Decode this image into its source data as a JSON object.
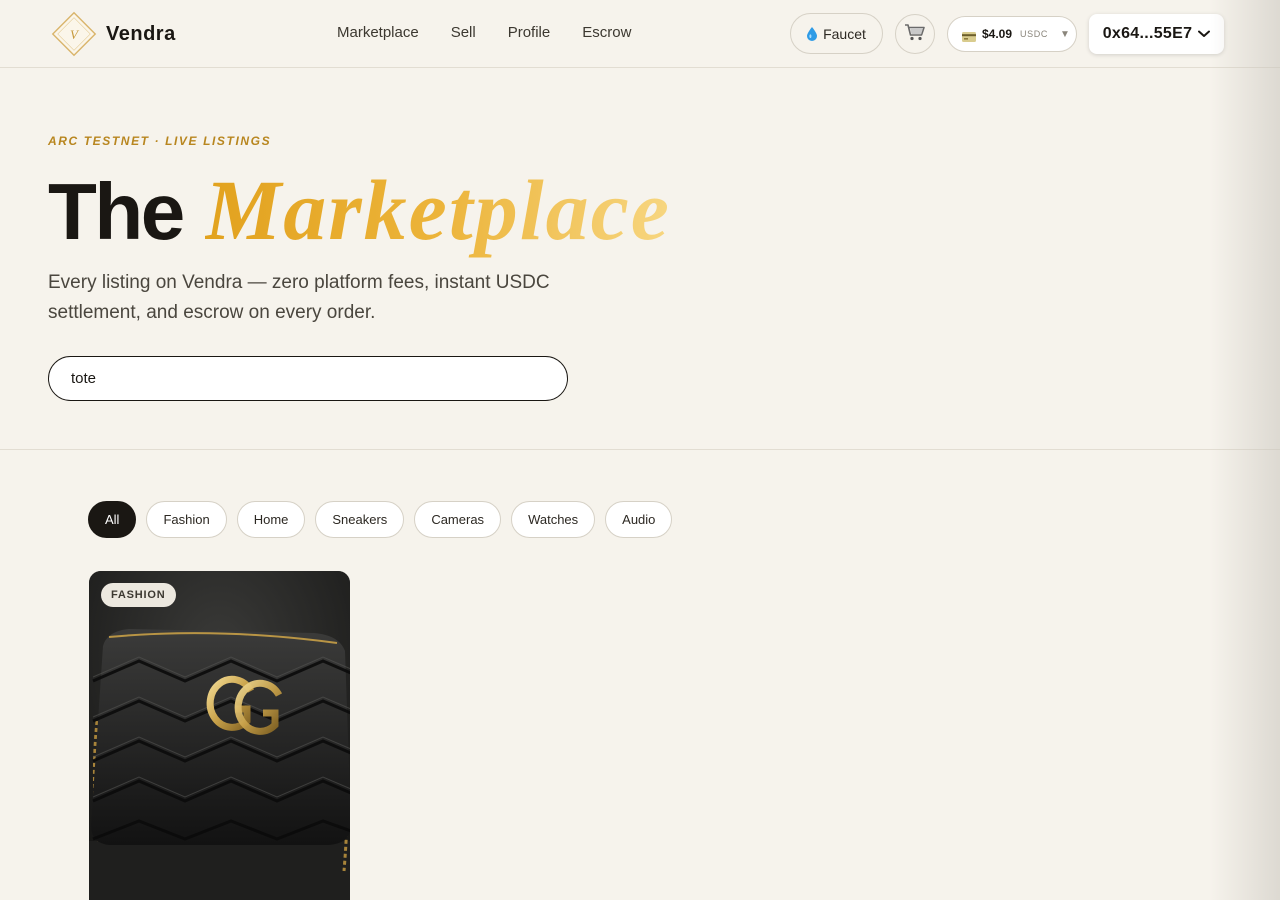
{
  "header": {
    "brand": "Vendra",
    "logo_letter": "V",
    "nav": [
      "Marketplace",
      "Sell",
      "Profile",
      "Escrow"
    ],
    "faucet_label": "Faucet",
    "faucet_icon": "droplet-icon",
    "cart_icon": "cart-icon",
    "balance": {
      "icon": "card-icon",
      "amount": "$4.09",
      "unit": "USDC",
      "caret": "▼"
    },
    "wallet": {
      "address": "0x64...55E7",
      "icon": "chevron-down-icon"
    }
  },
  "hero": {
    "eyebrow": "ARC TESTNET · LIVE LISTINGS",
    "title_plain": "The",
    "title_accent": "Marketplace",
    "subtitle": "Every listing on Vendra — zero platform fees, instant USDC settlement, and escrow on every order."
  },
  "search": {
    "value": "tote"
  },
  "filters": {
    "active": "All",
    "items": [
      "All",
      "Fashion",
      "Home",
      "Sneakers",
      "Cameras",
      "Watches",
      "Audio"
    ]
  },
  "products": [
    {
      "category_badge": "FASHION",
      "image": "black quilted leather crossbody bag with gold GG logo"
    }
  ],
  "colors": {
    "background": "#f6f3ec",
    "accent_gold": "#e2a21e",
    "ink": "#1a1713",
    "eyebrow": "#b8861f"
  }
}
